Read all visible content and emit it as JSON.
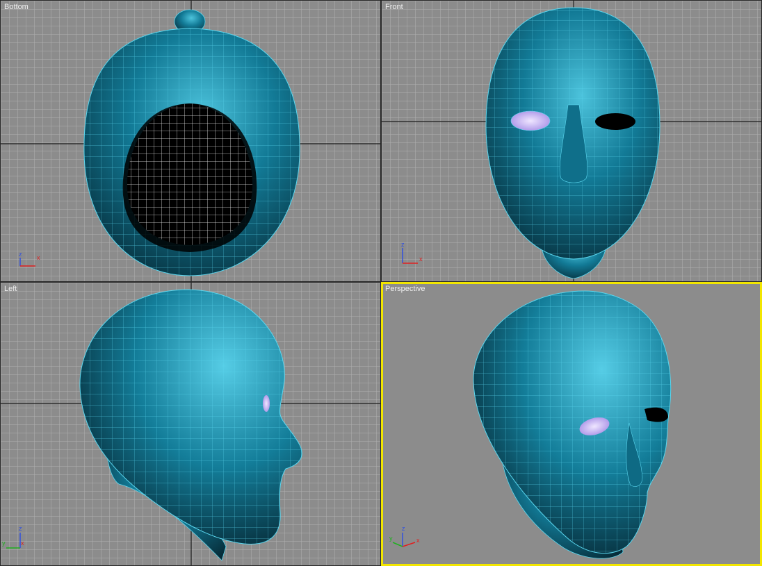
{
  "viewports": {
    "bottom": {
      "label": "Bottom",
      "axes": {
        "x": "x",
        "y": "z"
      }
    },
    "front": {
      "label": "Front",
      "axes": {
        "x": "x",
        "y": "z"
      }
    },
    "left": {
      "label": "Left",
      "axes": {
        "x": "x",
        "y": "z",
        "z": "y"
      }
    },
    "perspective": {
      "label": "Perspective",
      "axes": {
        "x": "x",
        "y": "z",
        "z": "y"
      },
      "active": true
    }
  },
  "colors": {
    "model": "#127a96",
    "wire": "#5ad6ee",
    "eye": "#c9b6f0",
    "active_border": "#f2e600",
    "axis_x": "#e02020",
    "axis_y": "#20b020",
    "axis_z": "#3050e0"
  },
  "icons": [
    "axis-tripod-icon"
  ]
}
